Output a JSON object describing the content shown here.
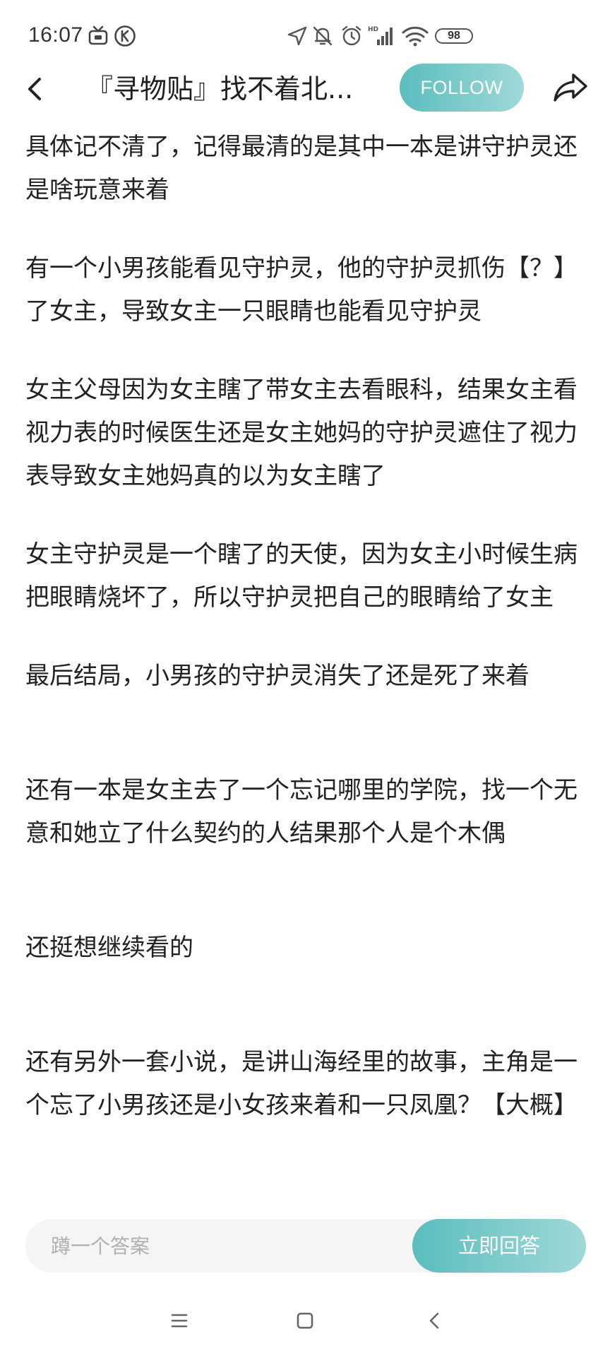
{
  "status_bar": {
    "time": "16:07",
    "battery": "98",
    "icons": [
      "tv-icon",
      "k-icon",
      "location-icon",
      "mute-icon",
      "alarm-icon",
      "hd-signal-icon",
      "wifi-icon",
      "battery-icon"
    ]
  },
  "header": {
    "title": "『寻物贴』找不着北...",
    "follow_label": "FOLLOW",
    "back_icon": "back-arrow-icon",
    "share_icon": "share-icon"
  },
  "content": {
    "paragraphs": [
      "具体记不清了，记得最清的是其中一本是讲守护灵还是啥玩意来着",
      "有一个小男孩能看见守护灵，他的守护灵抓伤【？】了女主，导致女主一只眼睛也能看见守护灵",
      "女主父母因为女主瞎了带女主去看眼科，结果女主看视力表的时候医生还是女主她妈的守护灵遮住了视力表导致女主她妈真的以为女主瞎了",
      "女主守护灵是一个瞎了的天使，因为女主小时候生病把眼睛烧坏了，所以守护灵把自己的眼睛给了女主",
      "最后结局，小男孩的守护灵消失了还是死了来着",
      "还有一本是女主去了一个忘记哪里的学院，找一个无意和她立了什么契约的人结果那个人是个木偶",
      "还挺想继续看的",
      "还有另外一套小说，是讲山海经里的故事，主角是一个忘了小男孩还是小女孩来着和一只凤凰？【大概】"
    ]
  },
  "answer_bar": {
    "placeholder": "蹲一个答案",
    "value": "",
    "button_label": "立即回答"
  },
  "nav_bar": {
    "icons": [
      "menu-icon",
      "home-icon",
      "back-icon"
    ]
  },
  "colors": {
    "accent_start": "#5bbdbd",
    "accent_end": "#9fd9d8",
    "text": "#222222",
    "placeholder": "#b0b0b0",
    "input_bg": "#f5f5f5"
  }
}
